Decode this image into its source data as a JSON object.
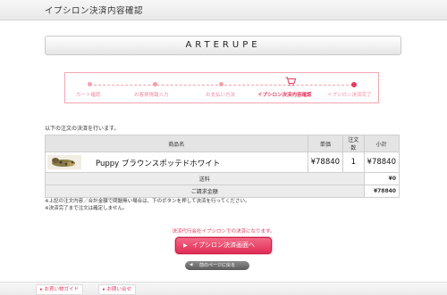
{
  "header": {
    "title": "イプシロン決済内容確認"
  },
  "brand": {
    "name": "ARTERUPE"
  },
  "steps": [
    {
      "label": "カート確認"
    },
    {
      "label": "お客様情報入力"
    },
    {
      "label": "お支払い方法"
    },
    {
      "label": "イプシロン決済内容確認",
      "current": true
    },
    {
      "label": "イプシロン決済完了"
    }
  ],
  "intro": "以下の注文の決済を行います。",
  "table": {
    "headers": {
      "product": "商品名",
      "price": "単価",
      "qty": "注文数",
      "subtotal": "小計"
    },
    "item": {
      "name": "Puppy ブラウンスポッテドホワイト",
      "price": "¥78840",
      "qty": "1",
      "subtotal": "¥78840"
    },
    "shipping": {
      "label": "送料",
      "value": "¥0"
    },
    "total": {
      "label": "ご請求金額",
      "value": "¥78840"
    }
  },
  "notes": [
    "※上記の注文内容／合計金額で問題無い場合は、下のボタンを押して決済を行ってください。",
    "※決済完了まで注文は確定しません。"
  ],
  "notice": "決済代行会社イプシロンでの決済になります。",
  "buttons": {
    "proceed": "イプシロン決済画面へ",
    "back": "前のページに戻る"
  },
  "footer": {
    "guide": "お買い物ガイド",
    "contact": "お問い合せ"
  },
  "colors": {
    "accent": "#e33a5f",
    "accent_light": "#f3a0ae"
  },
  "icons": {
    "cart": "cart-icon",
    "arrow": "arrow-right-icon"
  }
}
